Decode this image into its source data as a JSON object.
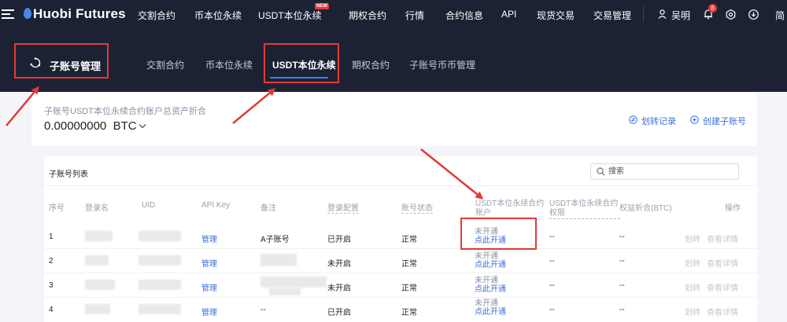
{
  "nav": {
    "logo": "Huobi Futures",
    "items": [
      "交割合约",
      "币本位永续",
      "USDT本位永续",
      "期权合约",
      "行情",
      "合约信息",
      "API",
      "现货交易",
      "交易管理"
    ],
    "new_badge": "NEW",
    "username": "吴明",
    "bell_count": "8",
    "edge_char": "简"
  },
  "subheader": {
    "title": "子账号管理",
    "tabs": [
      "交割合约",
      "币本位永续",
      "USDT本位永续",
      "期权合约",
      "子账号币币管理"
    ],
    "active_tab": "USDT本位永续"
  },
  "summary": {
    "label": "子账号USDT本位永续合约账户总资产折合",
    "value": "0.00000000",
    "unit": "BTC",
    "transfer_records": "划转记录",
    "create_subaccount": "创建子账号"
  },
  "list": {
    "title": "子账号列表",
    "search_placeholder": "搜索",
    "headers": {
      "index": "序号",
      "login": "登录名",
      "uid": "UID",
      "api_key": "API Key",
      "note": "备注",
      "login_config": "登录配置",
      "status": "账号状态",
      "usdt_account": "USDT本位永续合约账户",
      "usdt_permission": "USDT本位永续合约权限",
      "equity": "权益折合(BTC)",
      "actions": "操作"
    },
    "rows": [
      {
        "index": "1",
        "api": "管理",
        "note": "A子账号",
        "login_config": "已开启",
        "status": "正常",
        "open_state": "未开通",
        "open_link": "点此开通",
        "perm": "--",
        "equity": "--",
        "transfer": "划转",
        "detail": "查看详情"
      },
      {
        "index": "2",
        "api": "管理",
        "note": "",
        "login_config": "未开启",
        "status": "正常",
        "open_state": "未开通",
        "open_link": "点此开通",
        "perm": "--",
        "equity": "--",
        "transfer": "划转",
        "detail": "查看详情"
      },
      {
        "index": "3",
        "api": "管理",
        "note": "",
        "login_config": "未开启",
        "status": "正常",
        "open_state": "未开通",
        "open_link": "点此开通",
        "perm": "--",
        "equity": "--",
        "transfer": "划转",
        "detail": "查看详情"
      },
      {
        "index": "4",
        "api": "管理",
        "note": "--",
        "login_config": "已开启",
        "status": "正常",
        "open_state": "未开通",
        "open_link": "点此开通",
        "perm": "--",
        "equity": "--",
        "transfer": "划转",
        "detail": "查看详情"
      }
    ]
  },
  "colors": {
    "nav_bg": "#1c2234",
    "accent_blue": "#3d6fd8",
    "annotation_red": "#e53935"
  }
}
